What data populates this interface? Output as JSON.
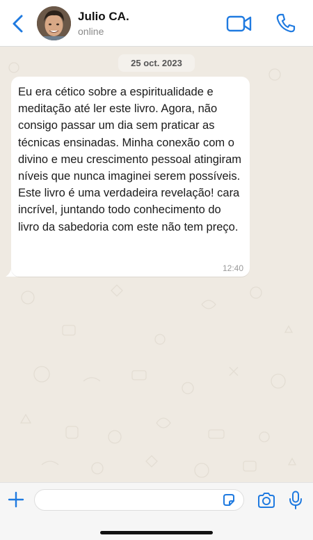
{
  "header": {
    "contact_name": "Julio CA.",
    "status": "online"
  },
  "chat": {
    "date_label": "25 oct. 2023",
    "messages": [
      {
        "text": "Eu era cético sobre a espiritualidade e meditação até ler este livro. Agora, não consigo passar um dia sem praticar as técnicas ensinadas. Minha conexão com o divino e meu crescimento pessoal atingiram níveis que nunca imaginei serem possíveis. Este livro é uma verdadeira revelação! cara incrível, juntando todo conhecimento do livro da sabedoria com este não tem preço.",
        "time": "12:40"
      }
    ]
  },
  "composer": {
    "input_value": "",
    "input_placeholder": ""
  },
  "colors": {
    "accent": "#1f7ae0",
    "chat_background": "#efeae2",
    "bubble": "#ffffff"
  },
  "icons": [
    "chevron-left-icon",
    "video-camera-icon",
    "phone-icon",
    "plus-icon",
    "sticker-icon",
    "camera-icon",
    "microphone-icon"
  ]
}
